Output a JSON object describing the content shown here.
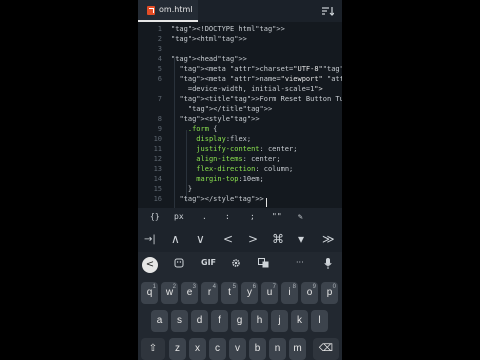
{
  "tab": {
    "file_name": "om.html",
    "file_icon": "html5-icon",
    "menu_icon": "sort-lines-icon"
  },
  "editor": {
    "lines": [
      {
        "n": "1",
        "code": "<!DOCTYPE html>"
      },
      {
        "n": "2",
        "code": "<html>"
      },
      {
        "n": "3",
        "code": ""
      },
      {
        "n": "4",
        "code": "<head>"
      },
      {
        "n": "5",
        "code": "  <meta charset=\"UTF-8\">"
      },
      {
        "n": "6",
        "code": "  <meta name=\"viewport\" content=\"width"
      },
      {
        "n": "",
        "code": "    =device-width, initial-scale=1\">"
      },
      {
        "n": "7",
        "code": "  <title>Form Reset Button Tutorial"
      },
      {
        "n": "",
        "code": "    </title>"
      },
      {
        "n": "8",
        "code": "  <style>"
      },
      {
        "n": "9",
        "code": "    .form {"
      },
      {
        "n": "10",
        "code": "      display:flex;"
      },
      {
        "n": "11",
        "code": "      justify-content: center;"
      },
      {
        "n": "12",
        "code": "      align-items: center;"
      },
      {
        "n": "13",
        "code": "      flex-direction: column;"
      },
      {
        "n": "14",
        "code": "      margin-top:10em;"
      },
      {
        "n": "15",
        "code": "    }"
      },
      {
        "n": "16",
        "code": "  </style>"
      }
    ]
  },
  "symbols": [
    "{}",
    "px",
    ".",
    ":",
    ";",
    "\"\"",
    "edit-symbol-icon"
  ],
  "symbol_labels": {
    "braces": "{}",
    "px": "px",
    "dot": ".",
    "colon": ":",
    "semicolon": ";",
    "quotes": "\"\""
  },
  "nav": {
    "tab_key": "→|",
    "up": "∧",
    "down": "∨",
    "left": "<",
    "right": ">",
    "cmd": "⌘",
    "dropdown": "▾",
    "skip": "≫"
  },
  "keyboard_toolbar": {
    "back": "<",
    "gif": "GIF",
    "more": "···"
  },
  "keyboard": {
    "row1": [
      {
        "k": "q",
        "n": "1"
      },
      {
        "k": "w",
        "n": "2"
      },
      {
        "k": "e",
        "n": "3"
      },
      {
        "k": "r",
        "n": "4"
      },
      {
        "k": "t",
        "n": "5"
      },
      {
        "k": "y",
        "n": "6"
      },
      {
        "k": "u",
        "n": "7"
      },
      {
        "k": "i",
        "n": "8"
      },
      {
        "k": "o",
        "n": "9"
      },
      {
        "k": "p",
        "n": "0"
      }
    ],
    "row2": [
      "a",
      "s",
      "d",
      "f",
      "g",
      "h",
      "j",
      "k",
      "l"
    ],
    "row3": [
      "z",
      "x",
      "c",
      "v",
      "b",
      "n",
      "m"
    ],
    "shift": "⇧",
    "backspace": "⌫"
  }
}
